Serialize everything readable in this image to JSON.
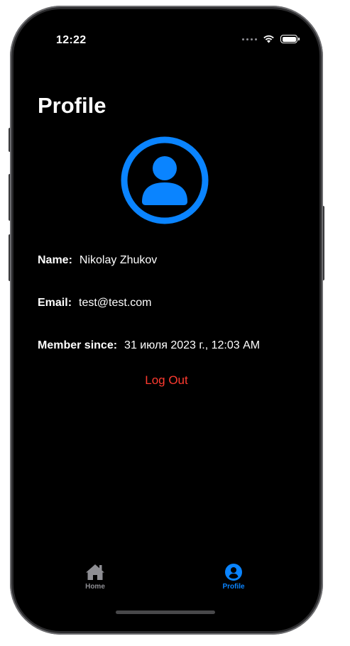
{
  "status_bar": {
    "time": "12:22"
  },
  "header": {
    "title": "Profile"
  },
  "profile": {
    "name_label": "Name:",
    "name_value": "Nikolay Zhukov",
    "email_label": "Email:",
    "email_value": "test@test.com",
    "since_label": "Member since:",
    "since_value": "31 июля 2023 г., 12:03 AM"
  },
  "actions": {
    "logout_label": "Log Out"
  },
  "tab_bar": {
    "tabs": [
      {
        "label": "Home",
        "icon": "house-icon",
        "selected": false
      },
      {
        "label": "Profile",
        "icon": "person-circle-icon",
        "selected": true
      }
    ]
  },
  "colors": {
    "accent": "#0a84ff",
    "destructive": "#ff3b30",
    "background": "#000000",
    "inactive": "#8e8e93"
  }
}
